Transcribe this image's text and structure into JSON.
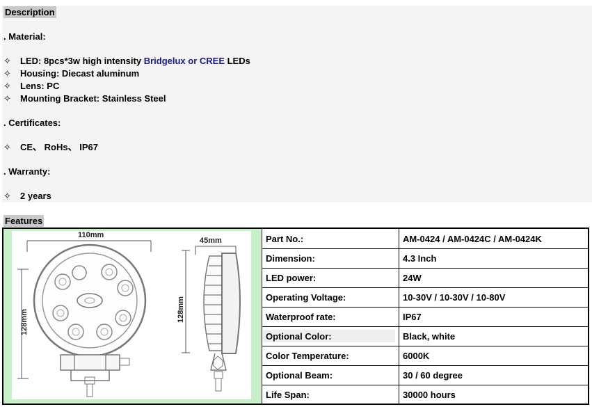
{
  "description": {
    "heading": "Description",
    "material_label": ". Material:",
    "material_items": [
      {
        "pre": "LED: 8pcs*3w high intensity ",
        "highlight": "Bridgelux or CREE",
        "post": " LEDs"
      },
      {
        "pre": "Housing: Diecast aluminum",
        "highlight": "",
        "post": ""
      },
      {
        "pre": "Lens: PC",
        "highlight": "",
        "post": ""
      },
      {
        "pre": "Mounting Bracket: Stainless Steel",
        "highlight": "",
        "post": ""
      }
    ],
    "certificates_label": ". Certificates:",
    "certificates_text": "CE、  RoHs、  IP67",
    "warranty_label": ". Warranty:",
    "warranty_text": "2 years",
    "bullet_glyph": "✧"
  },
  "features": {
    "heading": "Features",
    "diagram": {
      "width_label": "110mm",
      "height_label_front": "128mm",
      "depth_label": "45mm",
      "height_label_side": "128mm"
    },
    "specs": [
      {
        "label": "Part No.:",
        "value": "AM-0424 / AM-0424C / AM-0424K",
        "shaded": false
      },
      {
        "label": "Dimension:",
        "value": "4.3 Inch",
        "shaded": false
      },
      {
        "label": "LED power:",
        "value": "24W",
        "shaded": false
      },
      {
        "label": "Operating Voltage:",
        "value": "10-30V / 10-30V / 10-80V",
        "shaded": false
      },
      {
        "label": "Waterproof rate:",
        "value": "IP67",
        "shaded": false
      },
      {
        "label": "Optional Color:",
        "value": "Black, white",
        "shaded": true
      },
      {
        "label": "Color Temperature:",
        "value": "6000K",
        "shaded": false
      },
      {
        "label": "Optional Beam:",
        "value": "30 / 60 degree",
        "shaded": false
      },
      {
        "label": "Life Span:",
        "value": "30000 hours",
        "shaded": false
      }
    ]
  },
  "colors": {
    "heading_bg": "#c8c8c8",
    "desc_bg": "#f4f4f4",
    "image_frame": "#c8f0c8",
    "highlight_text": "#1a1a8c"
  }
}
